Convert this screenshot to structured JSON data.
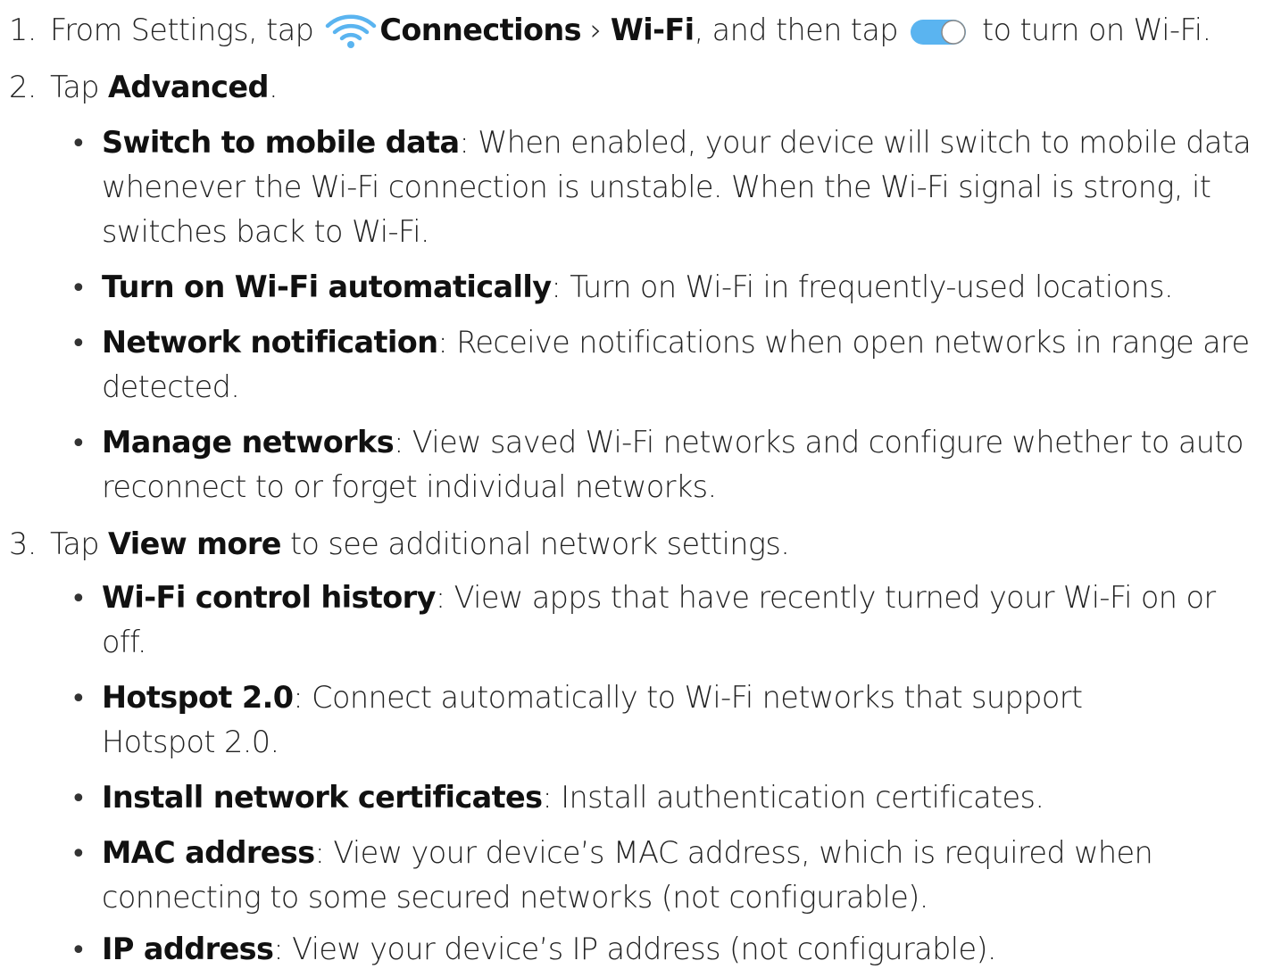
{
  "steps": [
    {
      "num": "1.",
      "parts": {
        "a": "From Settings, tap ",
        "connections": "Connections",
        "sep": " › ",
        "wifi": "Wi-Fi",
        "b": ", and then tap ",
        "c": " to turn on Wi-Fi."
      },
      "icons": [
        "wifi-icon",
        "toggle-switch-icon"
      ],
      "accent": "#5ab4f0"
    },
    {
      "num": "2.",
      "parts": {
        "a": "Tap ",
        "bold": "Advanced",
        "b": "."
      },
      "bullets": [
        {
          "term": "Switch to mobile data",
          "lines": [
            ": When enabled, your device will switch to mobile data",
            "whenever the Wi-Fi connection is unstable. When the Wi-Fi signal is strong, it",
            "switches back to Wi-Fi."
          ]
        },
        {
          "term": "Turn on Wi-Fi automatically",
          "lines": [
            ": Turn on Wi-Fi in frequently-used locations."
          ]
        },
        {
          "term": "Network notification",
          "lines": [
            ": Receive notifications when open networks in range are",
            "detected."
          ]
        },
        {
          "term": "Manage networks",
          "lines": [
            ": View saved Wi-Fi networks and configure whether to auto",
            "reconnect to or forget individual networks."
          ]
        }
      ]
    },
    {
      "num": "3.",
      "parts": {
        "a": "Tap ",
        "bold": "View more",
        "b": " to see additional network settings."
      },
      "bullets": [
        {
          "term": "Wi-Fi control history",
          "lines": [
            ": View apps that have recently turned your Wi-Fi on or",
            "off."
          ]
        },
        {
          "term": "Hotspot 2.0",
          "lines": [
            ": Connect automatically to Wi-Fi networks that support",
            "Hotspot 2.0."
          ]
        },
        {
          "term": "Install network certificates",
          "lines": [
            ": Install authentication certificates."
          ]
        },
        {
          "term": "MAC address",
          "lines": [
            ": View your device’s MAC address, which is required when",
            "connecting to some secured networks (not configurable)."
          ]
        },
        {
          "term": "IP address",
          "lines": [
            ": View your device’s IP address (not configurable)."
          ]
        }
      ]
    }
  ],
  "bullet_char": "•"
}
